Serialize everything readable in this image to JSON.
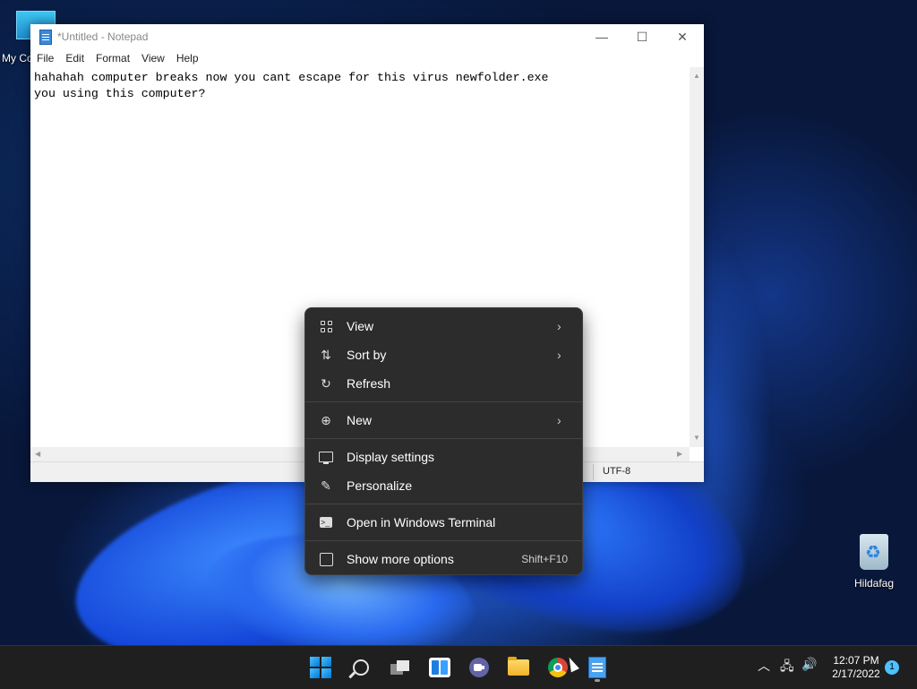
{
  "desktop": {
    "my_computer_label": "My Co",
    "recycle_label": "Hildafag"
  },
  "notepad": {
    "title": "*Untitled - Notepad",
    "menu": [
      "File",
      "Edit",
      "Format",
      "View",
      "Help"
    ],
    "content": "hahahah computer breaks now you cant escape for this virus newfolder.exe\nyou using this computer?",
    "encoding": "UTF-8",
    "controls": {
      "minimize": "—",
      "maximize": "☐",
      "close": "✕"
    }
  },
  "context_menu": {
    "items": [
      {
        "label": "View",
        "icon": "grid-icon",
        "submenu": true
      },
      {
        "label": "Sort by",
        "icon": "sort-icon",
        "submenu": true
      },
      {
        "label": "Refresh",
        "icon": "refresh-icon",
        "submenu": false
      },
      {
        "label": "New",
        "icon": "plus-circle-icon",
        "submenu": true
      },
      {
        "label": "Display settings",
        "icon": "display-icon",
        "submenu": false
      },
      {
        "label": "Personalize",
        "icon": "pen-icon",
        "submenu": false
      },
      {
        "label": "Open in Windows Terminal",
        "icon": "terminal-icon",
        "submenu": false
      },
      {
        "label": "Show more options",
        "icon": "more-options-icon",
        "shortcut": "Shift+F10"
      }
    ]
  },
  "taskbar": {
    "apps": [
      "start",
      "search",
      "task-view",
      "widgets",
      "chat",
      "file-explorer",
      "chrome",
      "notepad"
    ],
    "clock_time": "12:07 PM",
    "clock_date": "2/17/2022",
    "notification_count": "1"
  }
}
